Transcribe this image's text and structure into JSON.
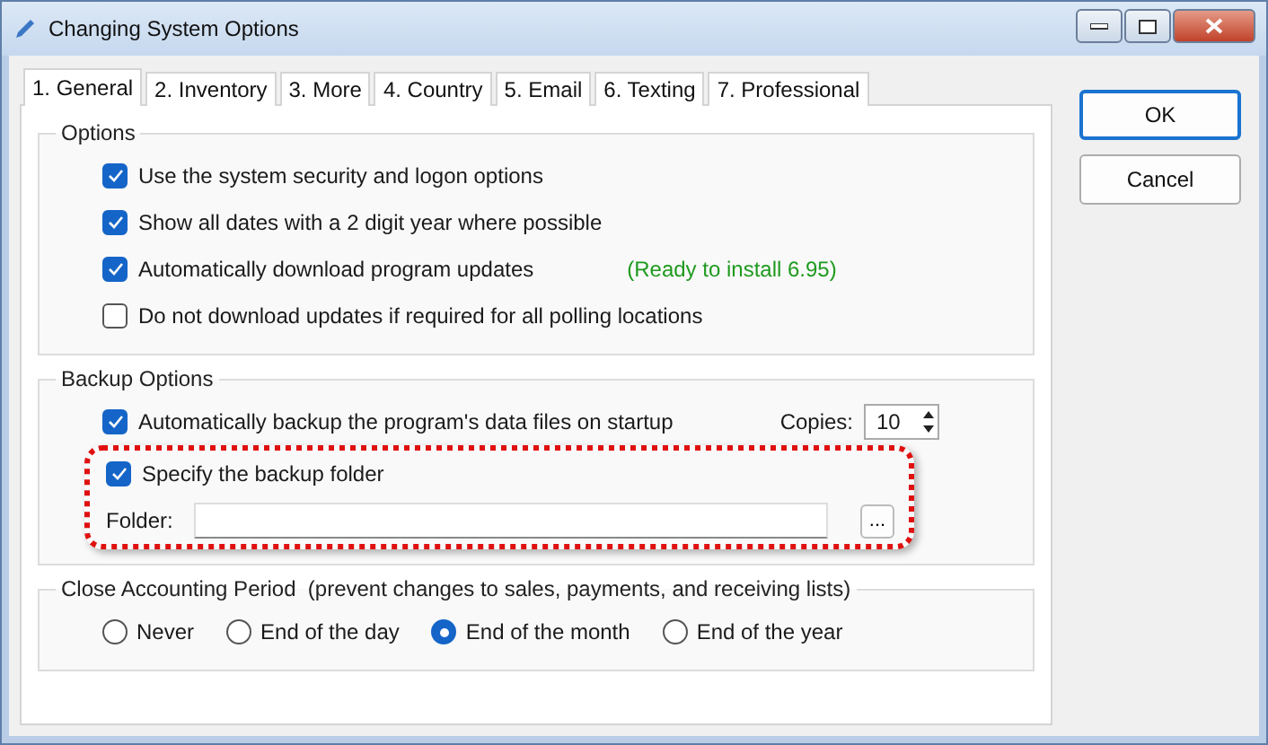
{
  "window": {
    "title": "Changing System Options"
  },
  "tabs": [
    {
      "label": "1. General",
      "selected": true
    },
    {
      "label": "2. Inventory",
      "selected": false
    },
    {
      "label": "3. More",
      "selected": false
    },
    {
      "label": "4. Country",
      "selected": false
    },
    {
      "label": "5. Email",
      "selected": false
    },
    {
      "label": "6. Texting",
      "selected": false
    },
    {
      "label": "7. Professional",
      "selected": false
    }
  ],
  "options": {
    "title": "Options",
    "items": [
      {
        "label": "Use the system security and logon options",
        "checked": true
      },
      {
        "label": "Show all dates with a 2 digit year where possible",
        "checked": true
      },
      {
        "label": "Automatically download program updates",
        "checked": true,
        "note": "(Ready to install 6.95)"
      },
      {
        "label": "Do not download updates if required for all polling locations",
        "checked": false
      }
    ]
  },
  "backup": {
    "title": "Backup Options",
    "auto": {
      "label": "Automatically backup the program's data files on startup",
      "checked": true
    },
    "copies": {
      "label": "Copies:",
      "value": "10"
    },
    "highlighted": true,
    "specify": {
      "label": "Specify the backup folder",
      "checked": true
    },
    "folder": {
      "label": "Folder:",
      "browse": "..."
    }
  },
  "period": {
    "title": "Close Accounting Period  (prevent changes to sales, payments, and receiving lists)",
    "choices": [
      {
        "label": "Never",
        "selected": false
      },
      {
        "label": "End of the day",
        "selected": false
      },
      {
        "label": "End of the month",
        "selected": true
      },
      {
        "label": "End of the year",
        "selected": false
      }
    ]
  },
  "buttons": [
    {
      "label": "OK",
      "default": true
    },
    {
      "label": "Cancel",
      "default": false
    }
  ]
}
